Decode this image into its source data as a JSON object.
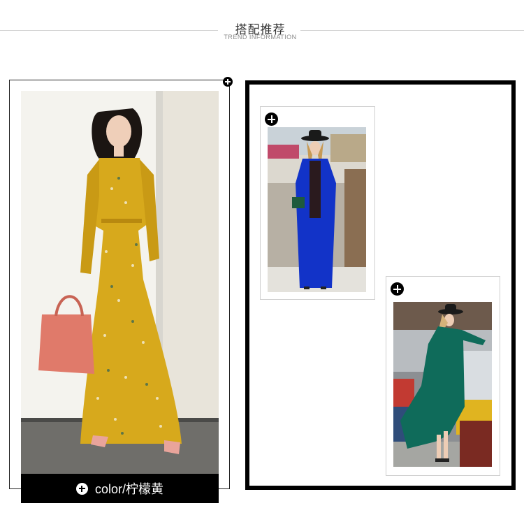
{
  "header": {
    "title": "搭配推荐",
    "subtitle": "TREND INFORMATION"
  },
  "main_look": {
    "color_label": "color/柠檬黄",
    "icon": "plus-circle-icon",
    "dress_color": "#d7a91c",
    "bag_color": "#e07a6a"
  },
  "looks": [
    {
      "icon": "plus-circle-icon",
      "coat_color": "#1233c8"
    },
    {
      "icon": "plus-circle-icon",
      "coat_color": "#0f6b5a"
    }
  ]
}
